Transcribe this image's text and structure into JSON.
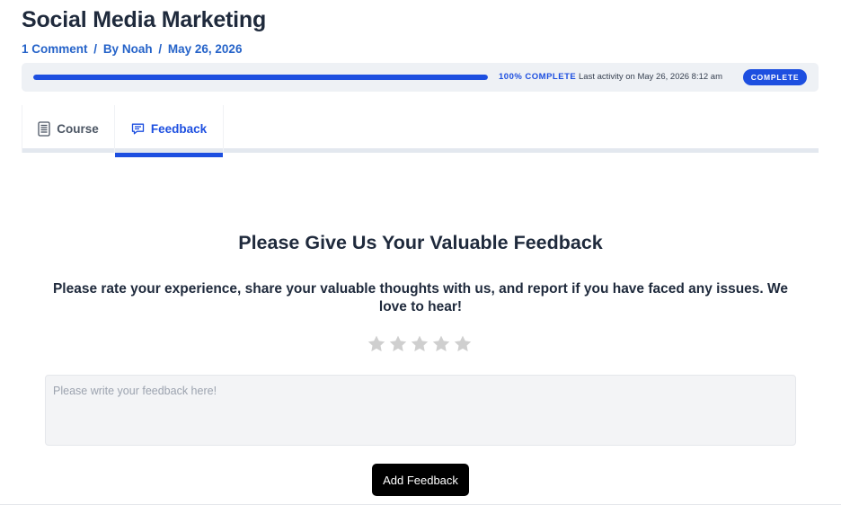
{
  "page": {
    "title": "Social Media Marketing",
    "meta": {
      "comments": "1 Comment",
      "by_prefix": "By",
      "author": "Noah",
      "date": "May 26, 2026",
      "separator": "/"
    }
  },
  "progress": {
    "percent": 100,
    "percent_label": "100% COMPLETE",
    "activity": "Last activity on May 26, 2026 8:12 am",
    "badge": "COMPLETE"
  },
  "tabs": [
    {
      "label": "Course",
      "icon": "document-icon",
      "active": false
    },
    {
      "label": "Feedback",
      "icon": "chat-bubble-icon",
      "active": true
    }
  ],
  "feedback": {
    "heading": "Please Give Us Your Valuable Feedback",
    "description": "Please rate your experience, share your valuable thoughts with us, and report if you have faced any issues. We love to hear!",
    "rating": {
      "value": 0,
      "max": 5
    },
    "placeholder": "Please write your feedback here!",
    "value": "",
    "submit_label": "Add Feedback"
  },
  "colors": {
    "accent": "#1d4fe0",
    "link": "#2563c9",
    "title": "#1f2a3c",
    "star_inactive": "#cfcfcf",
    "button_bg": "#000000"
  }
}
